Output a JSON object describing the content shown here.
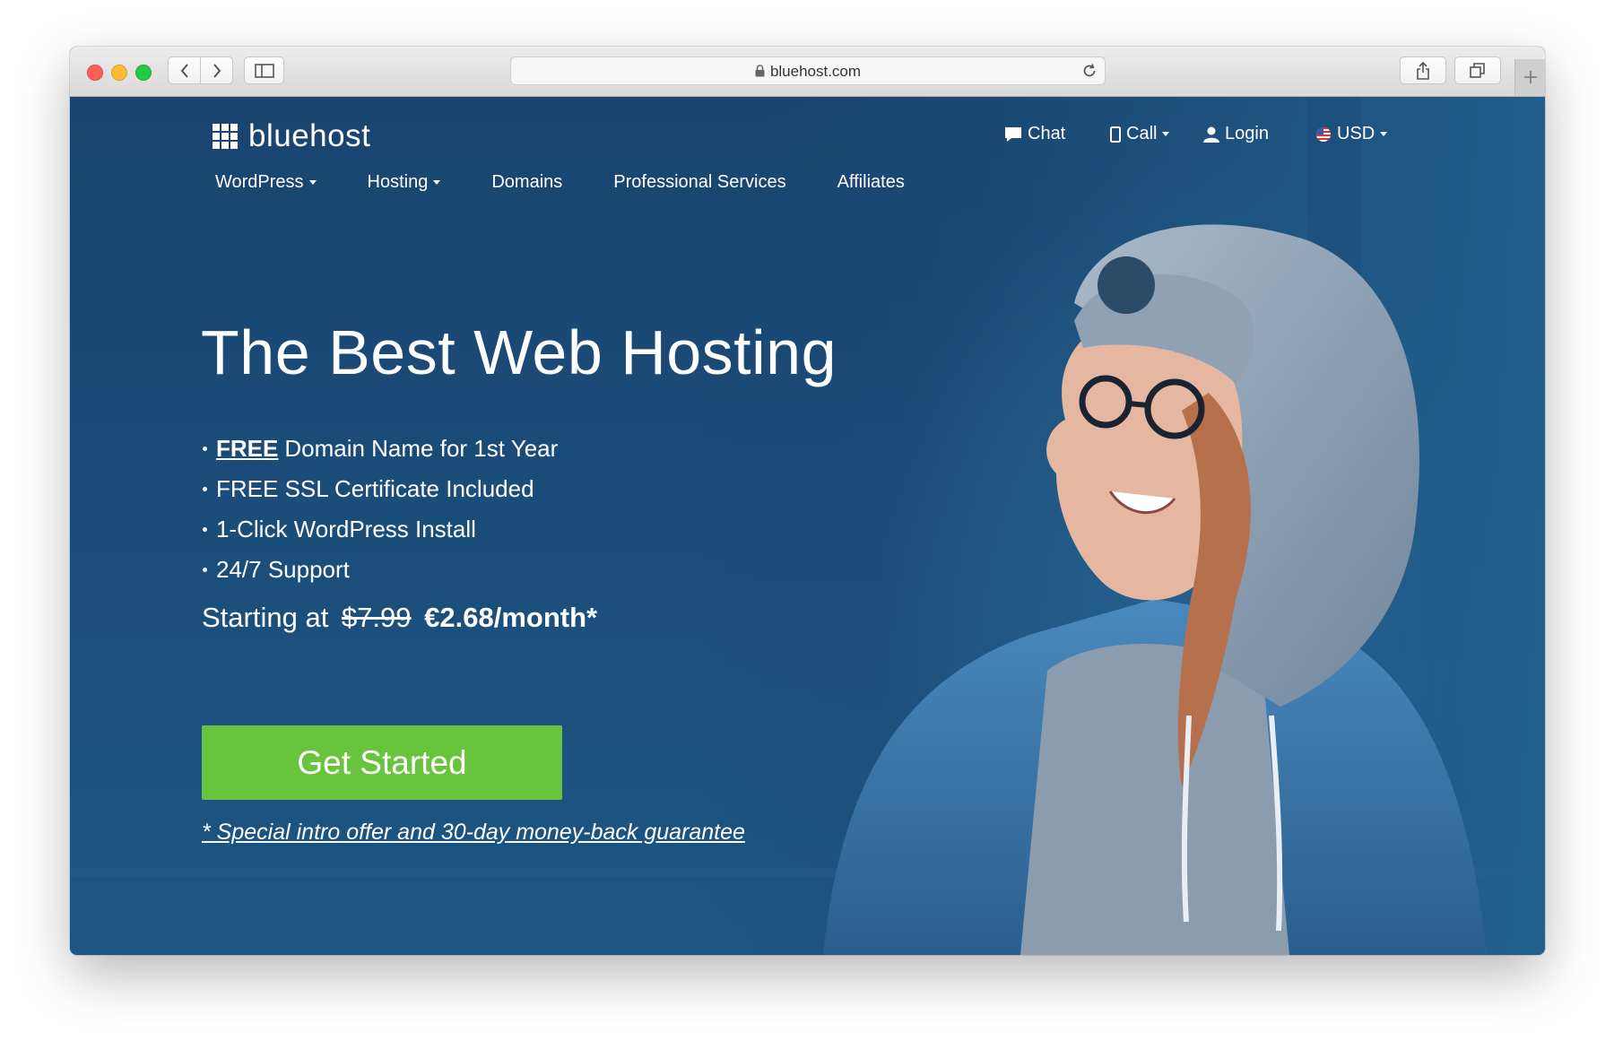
{
  "browser": {
    "url": "bluehost.com"
  },
  "site": {
    "logo_text": "bluehost",
    "utility": {
      "chat": "Chat",
      "call": "Call",
      "login": "Login",
      "currency": "USD"
    },
    "nav": [
      {
        "label": "WordPress",
        "dropdown": true
      },
      {
        "label": "Hosting",
        "dropdown": true
      },
      {
        "label": "Domains",
        "dropdown": false
      },
      {
        "label": "Professional Services",
        "dropdown": false
      },
      {
        "label": "Affiliates",
        "dropdown": false
      }
    ]
  },
  "hero": {
    "headline": "The Best Web Hosting",
    "features": [
      {
        "emphasis": "FREE",
        "text": "Domain Name for 1st Year"
      },
      {
        "emphasis": "",
        "text": "FREE SSL Certificate Included"
      },
      {
        "emphasis": "",
        "text": "1-Click WordPress Install"
      },
      {
        "emphasis": "",
        "text": "24/7 Support"
      }
    ],
    "price_prefix": "Starting at",
    "price_old": "$7.99",
    "price_new": "€2.68/month*",
    "cta_label": "Get Started",
    "guarantee": "* Special intro offer and 30-day money-back guarantee"
  },
  "colors": {
    "background": "#1d4f7c",
    "cta": "#67c43c"
  }
}
